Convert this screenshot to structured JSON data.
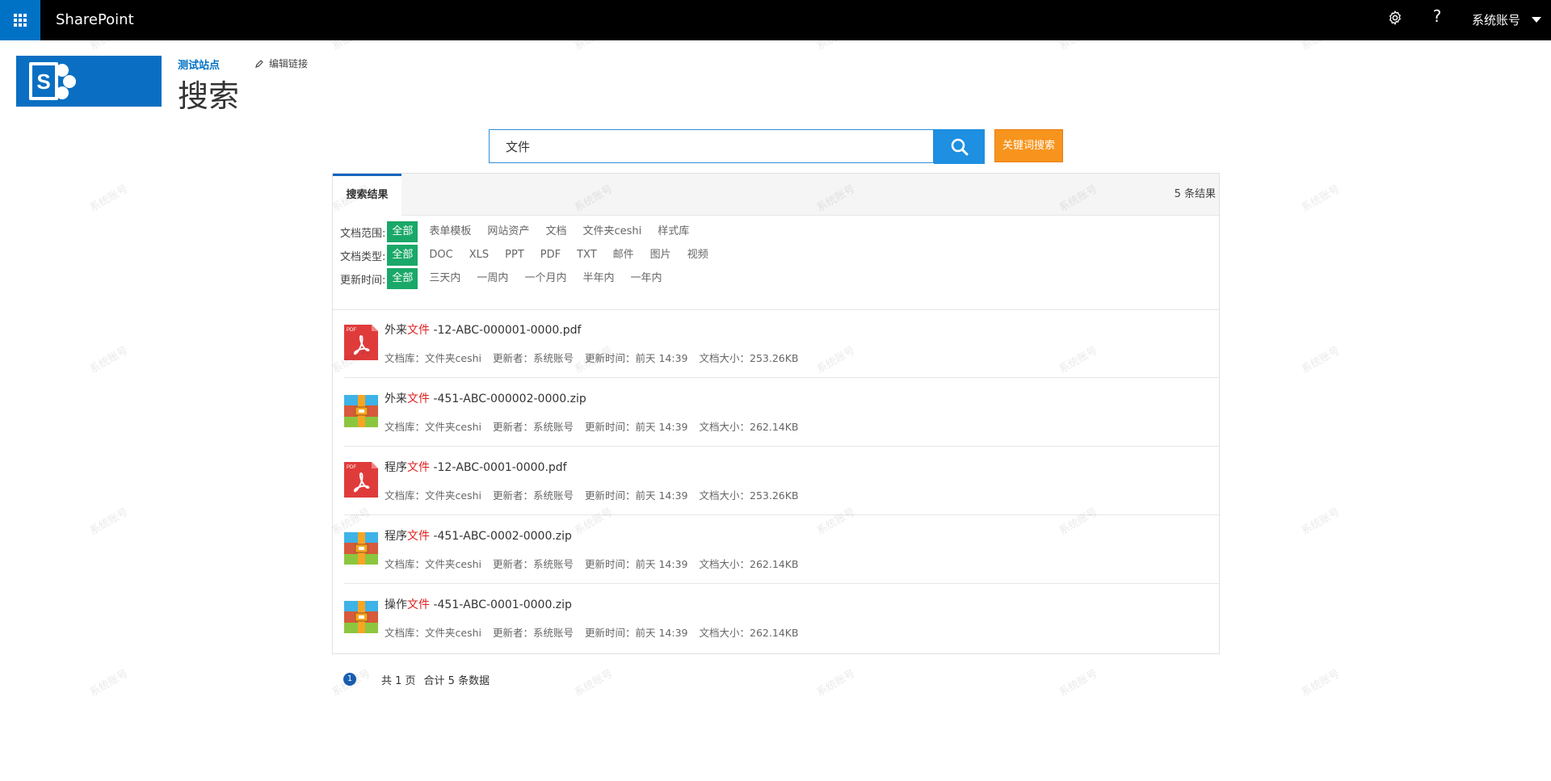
{
  "suitebar": {
    "app_name": "SharePoint",
    "account": "系统账号",
    "help_label": "?"
  },
  "site": {
    "name": "测试站点",
    "edit_links": "编辑链接",
    "page_title": "搜索"
  },
  "search": {
    "query": "文件",
    "keyword_button": "关键词搜索"
  },
  "results_panel": {
    "tab_label": "搜索结果",
    "count_text": "5 条结果",
    "filters": [
      {
        "label": "文档范围:",
        "options": [
          "全部",
          "表单模板",
          "网站资产",
          "文档",
          "文件夹ceshi",
          "样式库"
        ],
        "active": 0
      },
      {
        "label": "文档类型:",
        "options": [
          "全部",
          "DOC",
          "XLS",
          "PPT",
          "PDF",
          "TXT",
          "邮件",
          "图片",
          "视频"
        ],
        "active": 0
      },
      {
        "label": "更新时间:",
        "options": [
          "全部",
          "三天内",
          "一周内",
          "一个月内",
          "半年内",
          "一年内"
        ],
        "active": 0
      }
    ],
    "items": [
      {
        "icon": "pdf-icon",
        "prefix": "外来",
        "highlight": "文件",
        "suffix": " -12-ABC-000001-0000.pdf",
        "library": "文档库：文件夹ceshi",
        "updater": "更新者：系统账号",
        "updated": "更新时间：前天 14:39",
        "size": "文档大小：253.26KB"
      },
      {
        "icon": "zip-icon",
        "prefix": "外来",
        "highlight": "文件",
        "suffix": " -451-ABC-000002-0000.zip",
        "library": "文档库：文件夹ceshi",
        "updater": "更新者：系统账号",
        "updated": "更新时间：前天 14:39",
        "size": "文档大小：262.14KB"
      },
      {
        "icon": "pdf-icon",
        "prefix": "程序",
        "highlight": "文件",
        "suffix": " -12-ABC-0001-0000.pdf",
        "library": "文档库：文件夹ceshi",
        "updater": "更新者：系统账号",
        "updated": "更新时间：前天 14:39",
        "size": "文档大小：253.26KB"
      },
      {
        "icon": "zip-icon",
        "prefix": "程序",
        "highlight": "文件",
        "suffix": " -451-ABC-0002-0000.zip",
        "library": "文档库：文件夹ceshi",
        "updater": "更新者：系统账号",
        "updated": "更新时间：前天 14:39",
        "size": "文档大小：262.14KB"
      },
      {
        "icon": "zip-icon",
        "prefix": "操作",
        "highlight": "文件",
        "suffix": " -451-ABC-0001-0000.zip",
        "library": "文档库：文件夹ceshi",
        "updater": "更新者：系统账号",
        "updated": "更新时间：前天 14:39",
        "size": "文档大小：262.14KB"
      }
    ]
  },
  "pager": {
    "current_page": "1",
    "total_pages": "共 1 页",
    "total_records": "合计 5 条数据"
  },
  "watermark": "系统账号",
  "colors": {
    "suitebar": "#000000",
    "waffle": "#0072c6",
    "filter_active": "#1aa868",
    "keyword_button": "#f7941d",
    "search_button": "#1e8fe1",
    "highlight": "#e02020"
  }
}
